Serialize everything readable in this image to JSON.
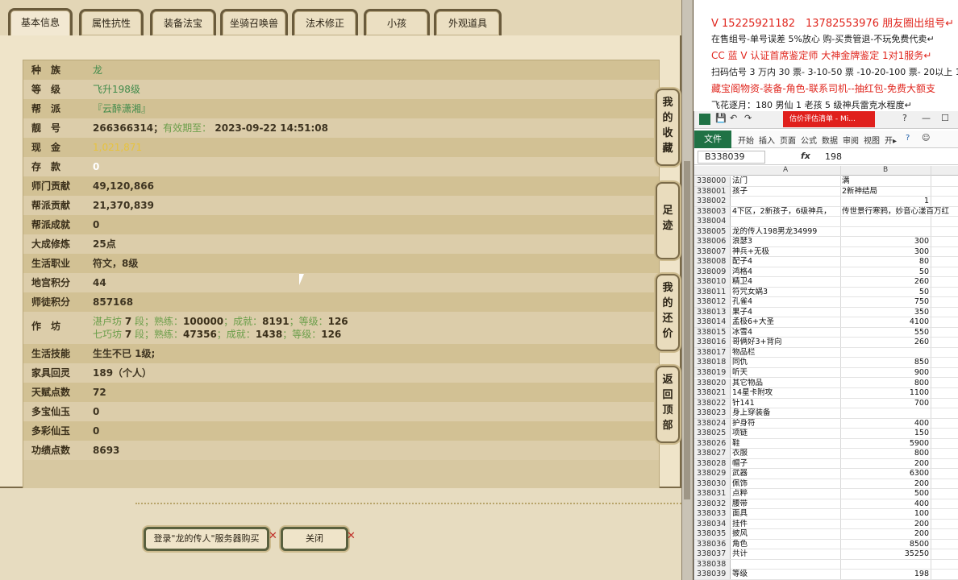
{
  "tabs": [
    "基本信息",
    "属性抗性",
    "装备法宝",
    "坐骑召唤兽",
    "法术修正",
    "小孩",
    "外观道具"
  ],
  "active_tab": "基本信息",
  "info_rows": [
    {
      "label": "种　族",
      "value": "龙",
      "style": "green"
    },
    {
      "label": "等　级",
      "value": "飞升198级",
      "style": "green"
    },
    {
      "label": "帮　派",
      "value": "『云醉潇湘』",
      "style": "green"
    },
    {
      "label": "靓　号",
      "value": "266366314",
      "extra_label": "有效期至：",
      "extra_value": "2023-09-22 14:51:08",
      "style": "dark"
    },
    {
      "label": "现　金",
      "value": "1,021,871",
      "style": "gold"
    },
    {
      "label": "存　款",
      "value": "0",
      "style": "white"
    },
    {
      "label": "师门贡献",
      "value": "49,120,866",
      "style": "dark"
    },
    {
      "label": "帮派贡献",
      "value": "21,370,839",
      "style": "dark"
    },
    {
      "label": "帮派成就",
      "value": "0",
      "style": "dark"
    },
    {
      "label": "大成修炼",
      "value": "25点",
      "style": "dark"
    },
    {
      "label": "生活职业",
      "value": "符文，8级",
      "style": "dark"
    },
    {
      "label": "地宫积分",
      "value": "44",
      "style": "dark"
    },
    {
      "label": "师徒积分",
      "value": "857168",
      "style": "dark"
    }
  ],
  "workshop": {
    "label": "作　坊",
    "line1": {
      "name": "湛卢坊",
      "n1": "7",
      "t1": "段；熟练：",
      "n2": "100000",
      "t2": "；成就：",
      "n3": "8191",
      "t3": "；等级：",
      "n4": "126"
    },
    "line2": {
      "name": "七巧坊",
      "n1": "7",
      "t1": "段；熟练：",
      "n2": "47356",
      "t2": "；成就：",
      "n3": "1438",
      "t3": "；等级：",
      "n4": "126"
    }
  },
  "info_rows2": [
    {
      "label": "生活技能",
      "value": "生生不已 1级;"
    },
    {
      "label": "家具回灵",
      "value": "189（个人）"
    },
    {
      "label": "天赋点数",
      "value": "72"
    },
    {
      "label": "多宝仙玉",
      "value": "0"
    },
    {
      "label": "多彩仙玉",
      "value": "0"
    },
    {
      "label": "功绩点数",
      "value": "8693"
    }
  ],
  "side_buttons": [
    "我的收藏",
    "足迹",
    "我的还价",
    "返回顶部"
  ],
  "footer": {
    "login_button": "登录\"龙的传人\"服务器购买",
    "close_button": "关闭"
  },
  "ad_lines": [
    {
      "text": "V 15225921182　13782553976 朋友圈出组号↵",
      "color": "red"
    },
    {
      "text": "在售组号-单号误差 5%放心 购-买贵管退-不玩免费代卖↵",
      "color": "black"
    },
    {
      "text": "CC 蓝 V 认证首席鉴定师 大神金牌鉴定 1对1服务↵",
      "color": "red"
    },
    {
      "text": "扫码估号 3 万内 30 票- 3-10-50 票 -10-20-100 票- 20以上 150",
      "color": "black"
    },
    {
      "text": "藏宝阁物资-装备-角色-联系司机--抽红包-免费大额支",
      "color": "red"
    },
    {
      "text": "飞花逐月：180 男仙 1 老孩 5 级神兵雷克水程度↵",
      "color": "black"
    }
  ],
  "excel": {
    "title": "估价评估清单 - Mi...",
    "file_tab": "文件",
    "ribbon_tabs": [
      "开始",
      "插入",
      "页面",
      "公式",
      "数据",
      "审阅",
      "视图",
      "开▸"
    ],
    "name_box": "B338039",
    "fx": "fx",
    "formula_value": "198",
    "col_headers": [
      "A",
      "B"
    ],
    "rows": [
      [
        "338000",
        "法门",
        "满"
      ],
      [
        "338001",
        "孩子",
        "2新神结局"
      ],
      [
        "338002",
        "",
        "1"
      ],
      [
        "338003",
        "4下区，2新孩子，6级神兵，",
        "传世景行寒鸦，妙音心漾百万红"
      ],
      [
        "338004",
        "",
        ""
      ],
      [
        "338005",
        "龙的传人198男龙34999",
        ""
      ],
      [
        "338006",
        "浪瑟3",
        "300"
      ],
      [
        "338007",
        "神兵+无极",
        "300"
      ],
      [
        "338008",
        "配子4",
        "80"
      ],
      [
        "338009",
        "鸿格4",
        "50"
      ],
      [
        "338010",
        "精卫4",
        "260"
      ],
      [
        "338011",
        "符咒女娲3",
        "50"
      ],
      [
        "338012",
        "孔雀4",
        "750"
      ],
      [
        "338013",
        "果子4",
        "350"
      ],
      [
        "338014",
        "孟极6+大圣",
        "4100"
      ],
      [
        "338015",
        "冰雪4",
        "550"
      ],
      [
        "338016",
        "哥俩好3+背向",
        "260"
      ],
      [
        "338017",
        "物品栏",
        ""
      ],
      [
        "338018",
        "同仇",
        "850"
      ],
      [
        "338019",
        "听天",
        "900"
      ],
      [
        "338020",
        "其它物品",
        "800"
      ],
      [
        "338021",
        "14星卡附攻",
        "1100"
      ],
      [
        "338022",
        "针141",
        "700"
      ],
      [
        "338023",
        "身上穿装备",
        ""
      ],
      [
        "338024",
        "护身符",
        "400"
      ],
      [
        "338025",
        "项链",
        "150"
      ],
      [
        "338026",
        "鞋",
        "5900"
      ],
      [
        "338027",
        "衣服",
        "800"
      ],
      [
        "338028",
        "帽子",
        "200"
      ],
      [
        "338029",
        "武器",
        "6300"
      ],
      [
        "338030",
        "佩饰",
        "200"
      ],
      [
        "338031",
        "点粹",
        "500"
      ],
      [
        "338032",
        "腰带",
        "400"
      ],
      [
        "338033",
        "面具",
        "100"
      ],
      [
        "338034",
        "挂件",
        "200"
      ],
      [
        "338035",
        "披风",
        "200"
      ],
      [
        "338036",
        "角色",
        "8500"
      ],
      [
        "338037",
        "共计",
        "35250"
      ],
      [
        "338038",
        "",
        ""
      ],
      [
        "338039",
        "等级",
        "198"
      ]
    ]
  }
}
